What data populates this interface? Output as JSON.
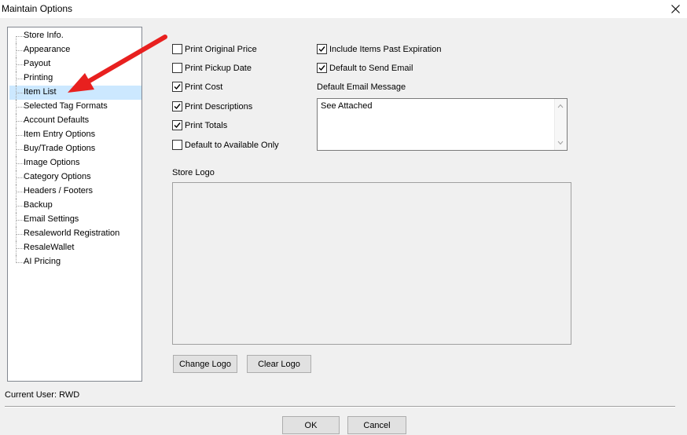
{
  "window": {
    "title": "Maintain Options"
  },
  "tree": {
    "items": [
      {
        "label": "Store Info."
      },
      {
        "label": "Appearance"
      },
      {
        "label": "Payout"
      },
      {
        "label": "Printing"
      },
      {
        "label": "Item List",
        "selected": true
      },
      {
        "label": "Selected Tag Formats"
      },
      {
        "label": "Account Defaults"
      },
      {
        "label": "Item Entry Options"
      },
      {
        "label": "Buy/Trade Options"
      },
      {
        "label": "Image Options"
      },
      {
        "label": "Category Options"
      },
      {
        "label": "Headers / Footers"
      },
      {
        "label": "Backup"
      },
      {
        "label": "Email Settings"
      },
      {
        "label": "Resaleworld Registration"
      },
      {
        "label": "ResaleWallet"
      },
      {
        "label": "AI Pricing"
      }
    ]
  },
  "options": {
    "print_original_price": {
      "label": "Print Original Price",
      "checked": false
    },
    "print_pickup_date": {
      "label": "Print Pickup Date",
      "checked": false
    },
    "print_cost": {
      "label": "Print Cost",
      "checked": true
    },
    "print_descriptions": {
      "label": "Print Descriptions",
      "checked": true
    },
    "print_totals": {
      "label": "Print Totals",
      "checked": true
    },
    "default_available_only": {
      "label": "Default to Available Only",
      "checked": false
    },
    "include_past_expiration": {
      "label": "Include Items Past Expiration",
      "checked": true
    },
    "default_send_email": {
      "label": "Default to Send Email",
      "checked": true
    }
  },
  "email": {
    "label": "Default Email Message",
    "value": "See Attached"
  },
  "logo": {
    "label": "Store Logo",
    "change_button": "Change Logo",
    "clear_button": "Clear Logo"
  },
  "footer": {
    "current_user": "Current User: RWD",
    "ok_button": "OK",
    "cancel_button": "Cancel"
  },
  "colors": {
    "selection": "#cce8ff",
    "annotation_arrow": "#e8201f"
  }
}
